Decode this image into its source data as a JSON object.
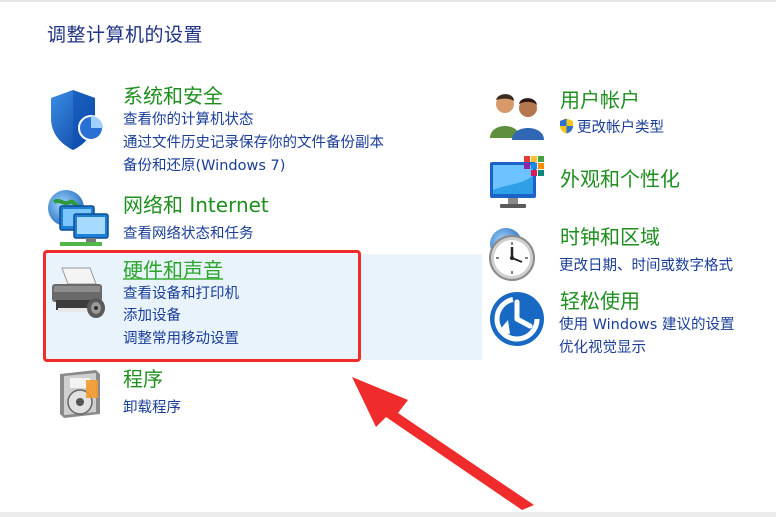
{
  "page": {
    "title": "调整计算机的设置"
  },
  "categories": {
    "system_security": {
      "title": "系统和安全",
      "links": [
        "查看你的计算机状态",
        "通过文件历史记录保存你的文件备份副本",
        "备份和还原(Windows 7)"
      ],
      "icon": "shield-icon"
    },
    "network": {
      "title": "网络和 Internet",
      "links": [
        "查看网络状态和任务"
      ],
      "icon": "network-icon"
    },
    "hardware_sound": {
      "title": "硬件和声音",
      "links": [
        "查看设备和打印机",
        "添加设备",
        "调整常用移动设置"
      ],
      "icon": "printer-icon"
    },
    "programs": {
      "title": "程序",
      "links": [
        "卸载程序"
      ],
      "icon": "programs-icon"
    },
    "user_accounts": {
      "title": "用户帐户",
      "links": [
        "更改帐户类型"
      ],
      "icon": "users-icon"
    },
    "appearance": {
      "title": "外观和个性化",
      "links": [],
      "icon": "monitor-icon"
    },
    "clock_region": {
      "title": "时钟和区域",
      "links": [
        "更改日期、时间或数字格式"
      ],
      "icon": "clock-icon"
    },
    "ease_of_access": {
      "title": "轻松使用",
      "links": [
        "使用 Windows 建议的设置",
        "优化视觉显示"
      ],
      "icon": "ease-of-access-icon"
    }
  },
  "colors": {
    "title": "#1e3287",
    "category_title": "#1e8f1e",
    "link": "#1a3d99",
    "highlight_bg": "#e8f3fc",
    "annotation_red": "#ef2b2b"
  }
}
